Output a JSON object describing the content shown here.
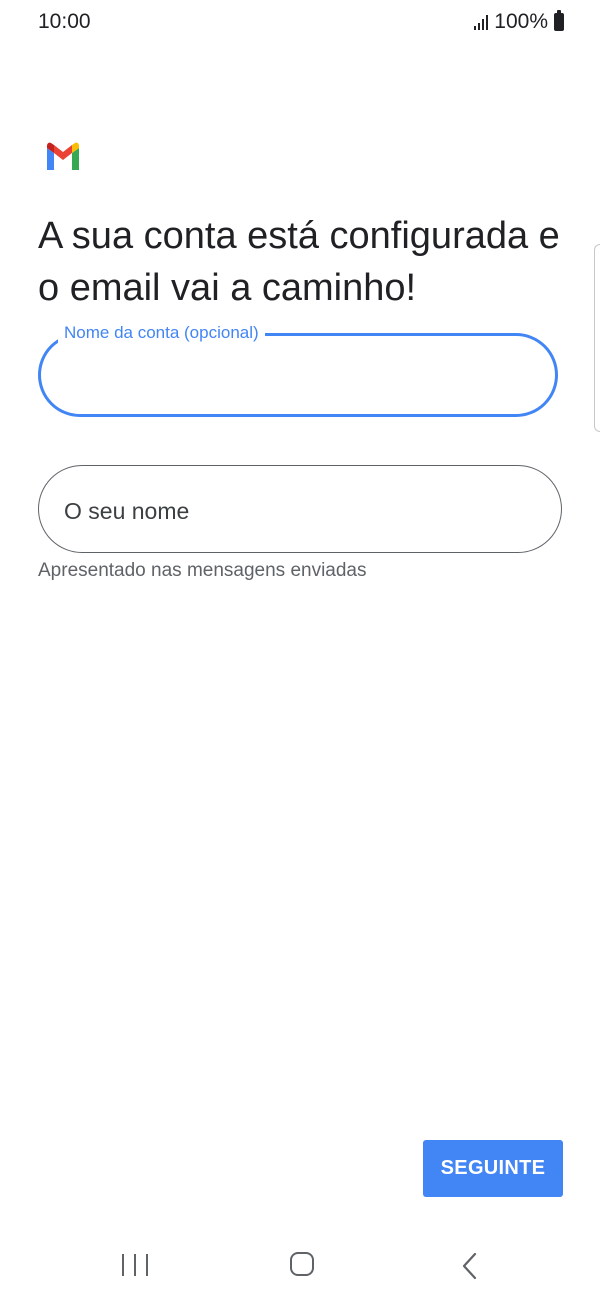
{
  "status_bar": {
    "time": "10:00",
    "battery": "100%",
    "icons": [
      "signal-icon",
      "battery-icon"
    ]
  },
  "header": {
    "logo": "gmail-logo-icon",
    "title": "A sua conta está configurada e o email vai a caminho!"
  },
  "form": {
    "account_name": {
      "label": "Nome da conta (opcional)",
      "value": ""
    },
    "your_name": {
      "placeholder": "O seu nome",
      "value": "",
      "helper": "Apresentado nas mensagens enviadas"
    }
  },
  "actions": {
    "next_label": "SEGUINTE"
  },
  "nav": {
    "icons": [
      "recent-apps-icon",
      "home-icon",
      "back-icon"
    ]
  },
  "colors": {
    "accent": "#4285f4",
    "text": "#202124",
    "secondary_text": "#5f6368",
    "gmail_red": "#ea4335",
    "gmail_blue": "#4285f4",
    "gmail_green": "#34a853",
    "gmail_yellow": "#fbbc04",
    "gmail_dark_red": "#c5221f"
  }
}
